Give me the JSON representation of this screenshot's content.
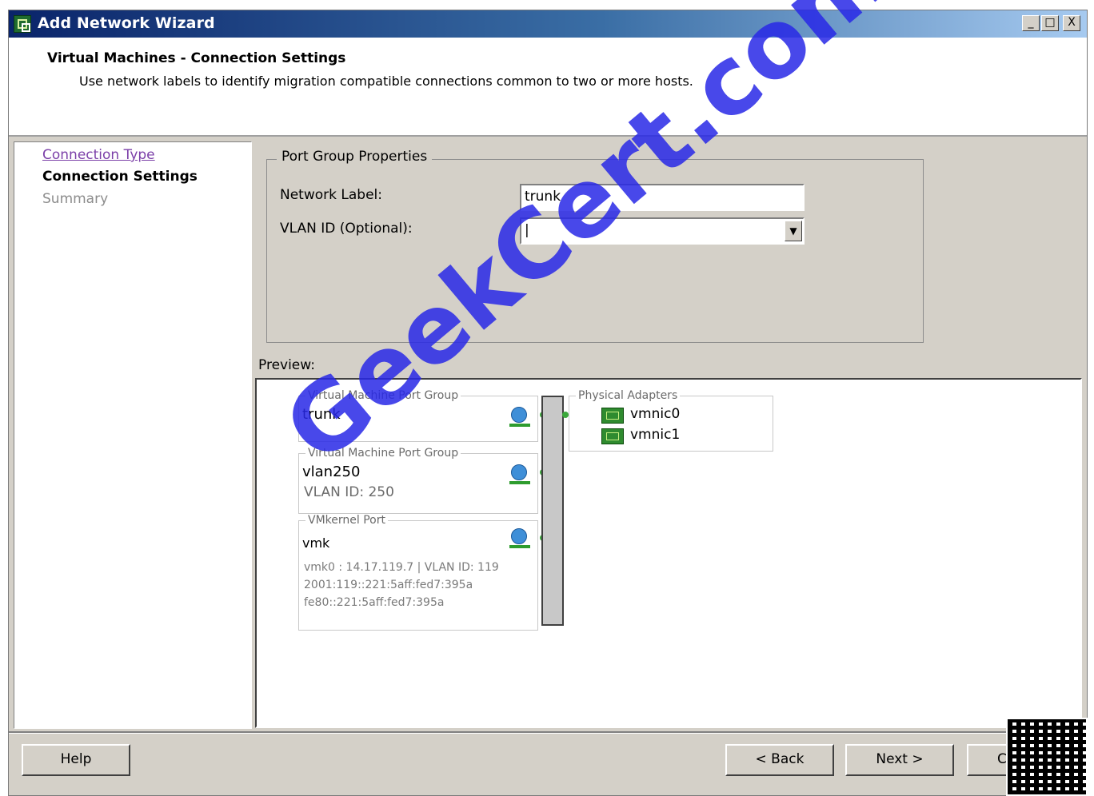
{
  "window": {
    "title": "Add Network Wizard",
    "controls": [
      "_",
      "□",
      "X"
    ]
  },
  "header": {
    "title": "Virtual Machines - Connection Settings",
    "subtitle": "Use network labels to identify migration compatible connections common to two or more hosts."
  },
  "nav": {
    "items": [
      {
        "label": "Connection Type",
        "state": "link"
      },
      {
        "label": "Connection Settings",
        "state": "current"
      },
      {
        "label": "Summary",
        "state": "disabled"
      }
    ]
  },
  "port_group_properties": {
    "legend": "Port Group Properties",
    "network_label": {
      "label": "Network Label:",
      "value": "trunk"
    },
    "vlan_id": {
      "label": "VLAN ID (Optional):",
      "value": "|"
    }
  },
  "preview": {
    "label": "Preview:",
    "groups": [
      {
        "legend": "Virtual Machine Port Group",
        "name": "trunk"
      },
      {
        "legend": "Virtual Machine Port Group",
        "name": "vlan250",
        "vlan": "VLAN ID: 250"
      },
      {
        "legend": "VMkernel Port",
        "name": "vmk",
        "details": [
          "vmk0 : 14.17.119.7 | VLAN ID: 119",
          "2001:119::221:5aff:fed7:395a",
          "fe80::221:5aff:fed7:395a"
        ]
      }
    ],
    "physical_adapters": {
      "legend": "Physical Adapters",
      "nics": [
        "vmnic0",
        "vmnic1"
      ]
    }
  },
  "buttons": {
    "help": "Help",
    "back": "< Back",
    "next": "Next >",
    "cancel": "C"
  },
  "watermark": "GeekCert.com",
  "colors": {
    "title_bar": "#0a246a",
    "dialog_bg": "#d4d0c8",
    "link": "#7b3fa8",
    "watermark": "#2828e6",
    "nic": "#2f8b2f"
  }
}
